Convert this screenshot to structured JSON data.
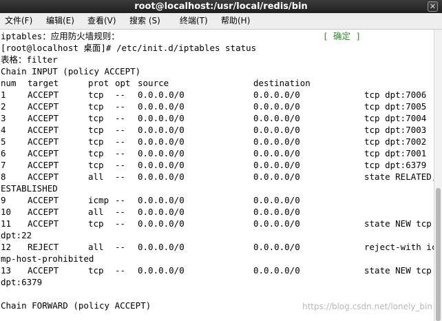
{
  "window": {
    "title": "root@localhost:/usr/local/redis/bin"
  },
  "menu": [
    {
      "label": "文件(F)"
    },
    {
      "label": "编辑(E)"
    },
    {
      "label": "查看(V)"
    },
    {
      "label": "搜索 (S)"
    },
    {
      "label": "终端(T)"
    },
    {
      "label": "帮助(H)"
    }
  ],
  "terminal": {
    "service_line": "iptables：应用防火墙规则：",
    "ok_label": "[ 确定 ]",
    "prompt": "[root@localhost 桌面]# /etc/init.d/iptables status",
    "table_line": "表格：filter",
    "chain_input": "Chain INPUT (policy ACCEPT)",
    "headers": {
      "num": "num",
      "target": "target",
      "prot": "prot",
      "opt": "opt",
      "source": "source",
      "destination": "destination"
    },
    "rules": [
      {
        "num": "1",
        "target": "ACCEPT",
        "prot": "tcp",
        "opt": "--",
        "source": "0.0.0.0/0",
        "destination": "0.0.0.0/0",
        "extra": "tcp dpt:7006",
        "wrap": ""
      },
      {
        "num": "2",
        "target": "ACCEPT",
        "prot": "tcp",
        "opt": "--",
        "source": "0.0.0.0/0",
        "destination": "0.0.0.0/0",
        "extra": "tcp dpt:7005",
        "wrap": ""
      },
      {
        "num": "3",
        "target": "ACCEPT",
        "prot": "tcp",
        "opt": "--",
        "source": "0.0.0.0/0",
        "destination": "0.0.0.0/0",
        "extra": "tcp dpt:7004",
        "wrap": ""
      },
      {
        "num": "4",
        "target": "ACCEPT",
        "prot": "tcp",
        "opt": "--",
        "source": "0.0.0.0/0",
        "destination": "0.0.0.0/0",
        "extra": "tcp dpt:7003",
        "wrap": ""
      },
      {
        "num": "5",
        "target": "ACCEPT",
        "prot": "tcp",
        "opt": "--",
        "source": "0.0.0.0/0",
        "destination": "0.0.0.0/0",
        "extra": "tcp dpt:7002",
        "wrap": ""
      },
      {
        "num": "6",
        "target": "ACCEPT",
        "prot": "tcp",
        "opt": "--",
        "source": "0.0.0.0/0",
        "destination": "0.0.0.0/0",
        "extra": "tcp dpt:7001",
        "wrap": ""
      },
      {
        "num": "7",
        "target": "ACCEPT",
        "prot": "tcp",
        "opt": "--",
        "source": "0.0.0.0/0",
        "destination": "0.0.0.0/0",
        "extra": "tcp dpt:6379",
        "wrap": ""
      },
      {
        "num": "8",
        "target": "ACCEPT",
        "prot": "all",
        "opt": "--",
        "source": "0.0.0.0/0",
        "destination": "0.0.0.0/0",
        "extra": "state RELATED,",
        "wrap": "ESTABLISHED"
      },
      {
        "num": "9",
        "target": "ACCEPT",
        "prot": "icmp",
        "opt": "--",
        "source": "0.0.0.0/0",
        "destination": "0.0.0.0/0",
        "extra": "",
        "wrap": ""
      },
      {
        "num": "10",
        "target": "ACCEPT",
        "prot": "all",
        "opt": "--",
        "source": "0.0.0.0/0",
        "destination": "0.0.0.0/0",
        "extra": "",
        "wrap": ""
      },
      {
        "num": "11",
        "target": "ACCEPT",
        "prot": "tcp",
        "opt": "--",
        "source": "0.0.0.0/0",
        "destination": "0.0.0.0/0",
        "extra": "state NEW tcp",
        "wrap": "dpt:22"
      },
      {
        "num": "12",
        "target": "REJECT",
        "prot": "all",
        "opt": "--",
        "source": "0.0.0.0/0",
        "destination": "0.0.0.0/0",
        "extra": "reject-with ic",
        "wrap": "mp-host-prohibited"
      },
      {
        "num": "13",
        "target": "ACCEPT",
        "prot": "tcp",
        "opt": "--",
        "source": "0.0.0.0/0",
        "destination": "0.0.0.0/0",
        "extra": "state NEW tcp",
        "wrap": "dpt:6379"
      }
    ],
    "chain_forward": "Chain FORWARD (policy ACCEPT)"
  },
  "watermark": "https://blog.csdn.net/lonely_bin",
  "colors": {
    "ok": "#2e8b2e",
    "titlebar": "#2b2b2b",
    "menubar": "#eeeeee"
  }
}
